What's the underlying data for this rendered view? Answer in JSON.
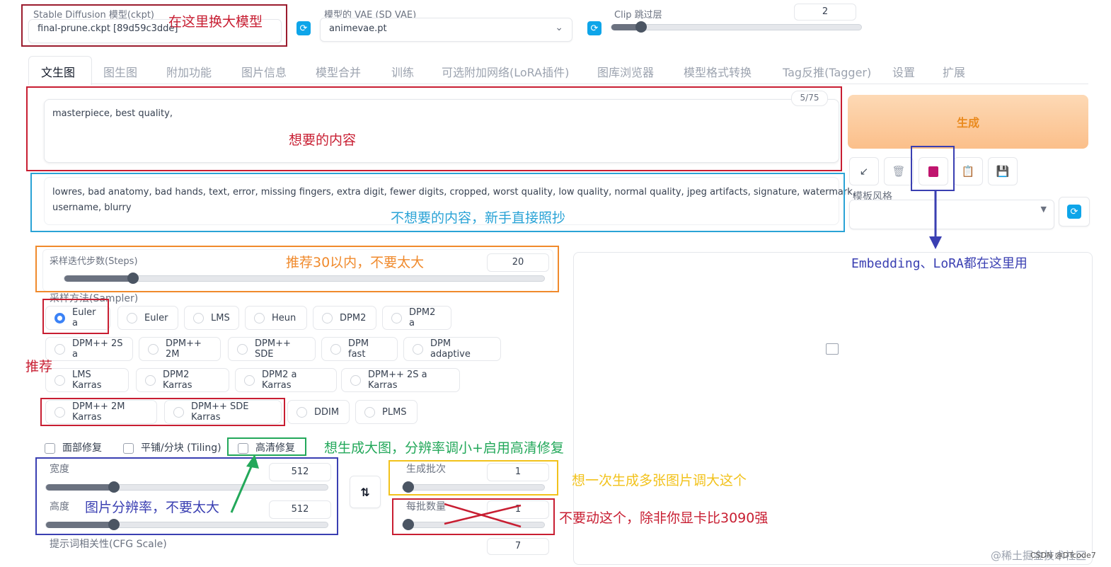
{
  "top": {
    "ckpt_label": "Stable Diffusion 模型(ckpt)",
    "ckpt_value": "final-prune.ckpt [89d59c3dde]",
    "vae_label": "模型的 VAE (SD VAE)",
    "vae_value": "animevae.pt",
    "clip_label": "Clip 跳过层",
    "clip_value": "2",
    "clip_level": 0.1
  },
  "tabs": [
    "文生图",
    "图生图",
    "附加功能",
    "图片信息",
    "模型合并",
    "训练",
    "可选附加网络(LoRA插件)",
    "图库浏览器",
    "模型格式转换",
    "Tag反推(Tagger)",
    "设置",
    "扩展"
  ],
  "prompt": {
    "text": "masterpiece, best quality,",
    "counter": "5/75",
    "negative_line1": "lowres, bad anatomy, bad hands, text, error, missing fingers, extra digit, fewer digits, cropped, worst quality, low quality, normal quality, jpeg artifacts, signature, watermark,",
    "negative_line2": "username, blurry"
  },
  "generate_label": "生成",
  "style_label": "模板风格",
  "steps": {
    "label": "采样迭代步数(Steps)",
    "value": "20",
    "level": 0.135
  },
  "sampler_label": "采样方法(Sampler)",
  "samplers": {
    "row1": [
      "Euler a",
      "Euler",
      "LMS",
      "Heun",
      "DPM2",
      "DPM2 a"
    ],
    "row2": [
      "DPM++ 2S a",
      "DPM++ 2M",
      "DPM++ SDE",
      "DPM fast",
      "DPM adaptive"
    ],
    "row3": [
      "LMS Karras",
      "DPM2 Karras",
      "DPM2 a Karras",
      "DPM++ 2S a Karras"
    ],
    "row4": [
      "DPM++ 2M Karras",
      "DPM++ SDE Karras",
      "DDIM",
      "PLMS"
    ]
  },
  "options": {
    "face": "面部修复",
    "tiling": "平铺/分块 (Tiling)",
    "hires": "高清修复"
  },
  "width": {
    "label": "宽度",
    "value": "512",
    "level": 0.23
  },
  "height": {
    "label": "高度",
    "value": "512",
    "level": 0.23
  },
  "batch_count": {
    "label": "生成批次",
    "value": "1",
    "level": 0.0
  },
  "batch_size": {
    "label": "每批数量",
    "value": "1",
    "level": 0.0
  },
  "cfg": {
    "label": "提示词相关性(CFG Scale)",
    "value": "7"
  },
  "annotations": {
    "model": "在这里换大模型",
    "want": "想要的内容",
    "negative": "不想要的内容，新手直接照抄",
    "steps": "推荐30以内，不要太大",
    "recommend": "推荐",
    "hires": "想生成大图，分辨率调小+启用高清修复",
    "resolution": "图片分辨率，不要太大",
    "batch": "想一次生成多张图片调大这个",
    "batch_size": "不要动这个，除非你显卡比3090强",
    "embedding": "Embedding、LoRA都在这里用"
  },
  "watermark": "@稀土掘金技术社区",
  "watermark2": "CSDN @DTcode7",
  "colors": {
    "red": "#c81e32",
    "blue": "#2aa3d6",
    "orange": "#f08a2c",
    "green": "#23a85a",
    "navy": "#3a3fb2",
    "yellow": "#f2c21b",
    "generate": "#fcc89a"
  }
}
